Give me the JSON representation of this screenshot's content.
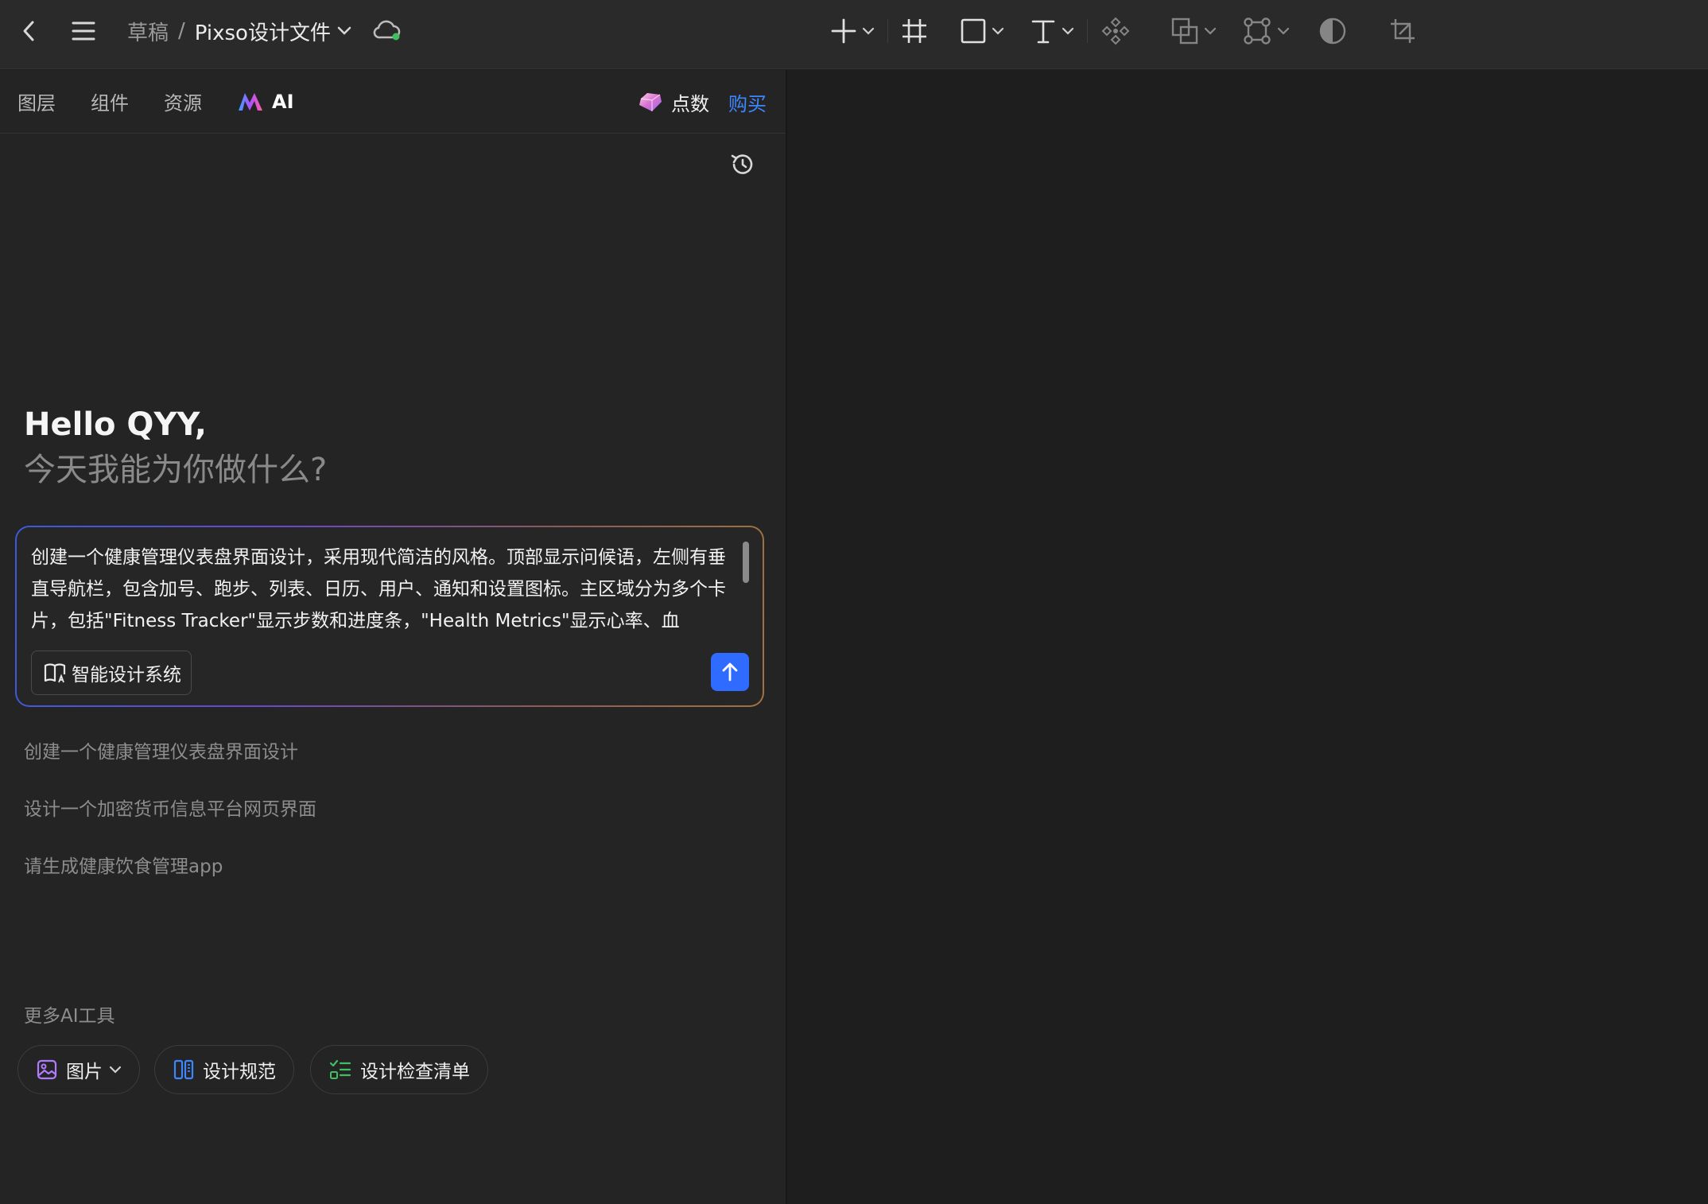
{
  "breadcrumb": {
    "root": "草稿",
    "separator": "/",
    "file": "Pixso设计文件"
  },
  "toolbar": {
    "tools": [
      "add-tool",
      "frame-tool",
      "shape-tool",
      "text-tool",
      "component-tool",
      "boolean-tool",
      "vector-network-tool",
      "mask-tool",
      "crop-tool"
    ]
  },
  "panel": {
    "tabs": {
      "layers": "图层",
      "components": "组件",
      "resources": "资源",
      "ai": "AI"
    },
    "points": {
      "label": "点数",
      "buy": "购买"
    }
  },
  "greeting": {
    "line1": "Hello QYY,",
    "line2": "今天我能为你做什么?"
  },
  "composer": {
    "text": "创建一个健康管理仪表盘界面设计，采用现代简洁的风格。顶部显示问候语，左侧有垂直导航栏，包含加号、跑步、列表、日历、用户、通知和设置图标。主区域分为多个卡片，包括\"Fitness Tracker\"显示步数和进度条，\"Health Metrics\"显示心率、血",
    "design_system_label": "智能设计系统"
  },
  "suggestions": [
    "创建一个健康管理仪表盘界面设计",
    "设计一个加密货币信息平台网页界面",
    "请生成健康饮食管理app"
  ],
  "more_tools": {
    "title": "更多AI工具",
    "image": "图片",
    "design_spec": "设计规范",
    "design_checklist": "设计检查清单"
  },
  "colors": {
    "accent": "#2f6bff",
    "buy_link": "#3e86ff",
    "background": "#1e1e1e",
    "panel": "#242424"
  }
}
